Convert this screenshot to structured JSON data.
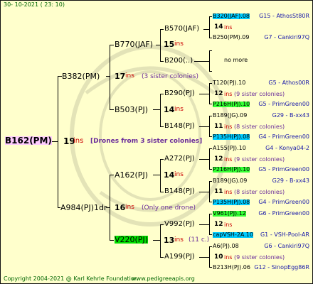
{
  "header": {
    "date": "30- 10-2021 ( 23: 10)"
  },
  "footer": {
    "copyright": "Copyright 2004-2021 @ Karl Kehrle Foundation",
    "site": "www.pedigreeapis.org"
  },
  "root": {
    "name": "B162(PM)",
    "ins": "19",
    "ins_word": "ins",
    "note": "[Drones from 3 sister colonies]",
    "color": "#ffccff"
  },
  "gen1": [
    {
      "name": "B382(PM)",
      "ins": "17",
      "ins_word": "ins",
      "note": "(3 sister colonies)"
    },
    {
      "name": "A984(PJ)1dr",
      "ins": "16",
      "ins_word": "ins",
      "note": "(Only one drone)"
    }
  ],
  "gen2": [
    {
      "name": "B770(JAF)",
      "ins": "15",
      "ins_word": "ins"
    },
    {
      "name": "B503(PJ)",
      "ins": "14",
      "ins_word": "ins"
    },
    {
      "name": "A162(PJ)",
      "ins": "14",
      "ins_word": "ins"
    },
    {
      "name": "V220(PJ)",
      "ins": "13",
      "ins_word": "ins",
      "note": "(11 c.)",
      "color": "#00dd00"
    }
  ],
  "gen3": [
    {
      "name": "B570(JAF)",
      "ins": "14",
      "ins_word": "ins"
    },
    {
      "name": "B200(..)",
      "ins": "",
      "ins_word": ""
    },
    {
      "name": "B290(PJ)",
      "ins": "14",
      "ins_word": "ins"
    },
    {
      "name": "B148(PJ)",
      "ins": "",
      "ins_word": "ins"
    },
    {
      "name": "A272(PJ)",
      "ins": "",
      "ins_word": "ins"
    },
    {
      "name": "B148(PJ)",
      "ins": "",
      "ins_word": "ins"
    },
    {
      "name": "V992(PJ)",
      "ins": "12",
      "ins_word": "ins"
    },
    {
      "name": "A199(PJ)",
      "ins": "",
      "ins_word": "ins"
    }
  ],
  "gen4": [
    {
      "text": "B320(JAF).08",
      "suffix": "G15 - AthosSt80R",
      "color": "#00ccff"
    },
    {
      "text": "14",
      "suffix": "ins",
      "kind": "ins"
    },
    {
      "text": "B250(PM).09",
      "suffix": "G7 - Cankiri97Q"
    },
    {
      "text": "no more",
      "kind": "nomore"
    },
    {
      "text": "T120(PJ).10",
      "suffix": "G5 - Athos00R"
    },
    {
      "text": "12",
      "suffix": "ins",
      "note": "(9 sister colonies)",
      "kind": "ins"
    },
    {
      "text": "P216H(PJ).10",
      "suffix": "G5 - PrimGreen00",
      "color": "#33ff33"
    },
    {
      "text": "B189(JG).09",
      "suffix": "G29 - B-xx43"
    },
    {
      "text": "11",
      "suffix": "ins",
      "note": "(8 sister colonies)",
      "kind": "ins"
    },
    {
      "text": "P135H(PJ).08",
      "suffix": "G4 - PrimGreen00",
      "color": "#00ccff"
    },
    {
      "text": "A155(PJ).10",
      "suffix": "G4 - Konya04-2"
    },
    {
      "text": "12",
      "suffix": "ins",
      "note": "(9 sister colonies)",
      "kind": "ins"
    },
    {
      "text": "P216H(PJ).10",
      "suffix": "G5 - PrimGreen00",
      "color": "#33ff33"
    },
    {
      "text": "B189(JG).09",
      "suffix": "G29 - B-xx43"
    },
    {
      "text": "11",
      "suffix": "ins",
      "note": "(8 sister colonies)",
      "kind": "ins"
    },
    {
      "text": "P135H(PJ).08",
      "suffix": "G4 - PrimGreen00",
      "color": "#00ccff"
    },
    {
      "text": "V961(PJ).12",
      "suffix": "G6 - PrimGreen00",
      "color": "#33ff33"
    },
    {
      "text": "12",
      "suffix": "ins",
      "kind": "ins"
    },
    {
      "text": "capVSH-2A.10",
      "suffix": "G1 - VSH-Pool-AR",
      "color": "#00ccff"
    },
    {
      "text": "A6(PJ).08",
      "suffix": "G6 - Cankiri97Q"
    },
    {
      "text": "10",
      "suffix": "ins",
      "note": "(9 sister colonies)",
      "kind": "ins"
    },
    {
      "text": "B213H(PJ).06",
      "suffix": "G12 - SinopEgg86R"
    }
  ]
}
